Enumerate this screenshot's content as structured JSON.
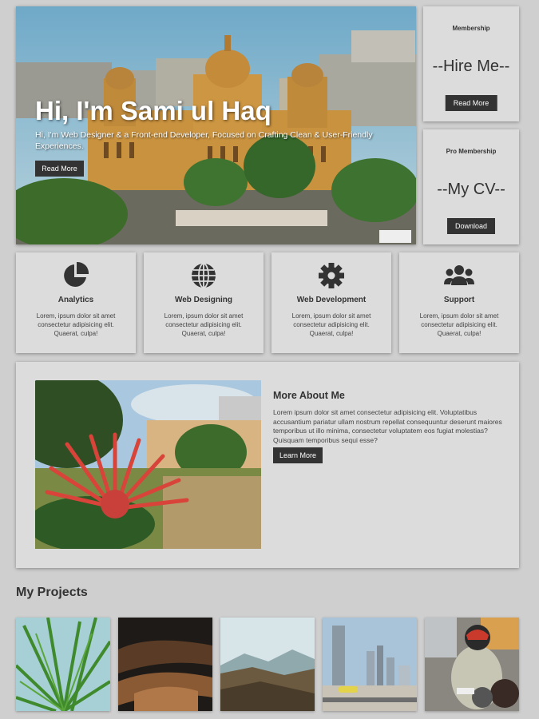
{
  "hero": {
    "title": "Hi, I'm Sami ul Haq",
    "subtitle": "Hi, I'm Web Designer & a Front-end Developer, Focused on Crafting Clean & User-Friendly Experiences.",
    "button": "Read More"
  },
  "membership": [
    {
      "label": "Membership",
      "big": "--Hire Me--",
      "button": "Read More"
    },
    {
      "label": "Pro Membership",
      "big": "--My CV--",
      "button": "Download"
    }
  ],
  "services": [
    {
      "icon": "pie-chart-icon",
      "title": "Analytics",
      "text": "Lorem, ipsum dolor sit amet consectetur adipisicing elit. Quaerat, culpa!"
    },
    {
      "icon": "globe-icon",
      "title": "Web Designing",
      "text": "Lorem, ipsum dolor sit amet consectetur adipisicing elit. Quaerat, culpa!"
    },
    {
      "icon": "gear-icon",
      "title": "Web Development",
      "text": "Lorem, ipsum dolor sit amet consectetur adipisicing elit. Quaerat, culpa!"
    },
    {
      "icon": "users-icon",
      "title": "Support",
      "text": "Lorem, ipsum dolor sit amet consectetur adipisicing elit. Quaerat, culpa!"
    }
  ],
  "about": {
    "title": "More About Me",
    "text": "Lorem ipsum dolor sit amet consectetur adipisicing elit. Voluptatibus accusantium pariatur ullam nostrum repellat consequuntur deserunt maiores temporibus ut illo minima, consectetur voluptatem eos fugiat molestias? Quisquam temporibus sequi esse?",
    "button": "Learn More"
  },
  "projects": {
    "title": "My Projects"
  },
  "colors": {
    "background": "#cfcfcf",
    "card": "#dcdcdc",
    "button": "#333333",
    "text": "#333333"
  }
}
